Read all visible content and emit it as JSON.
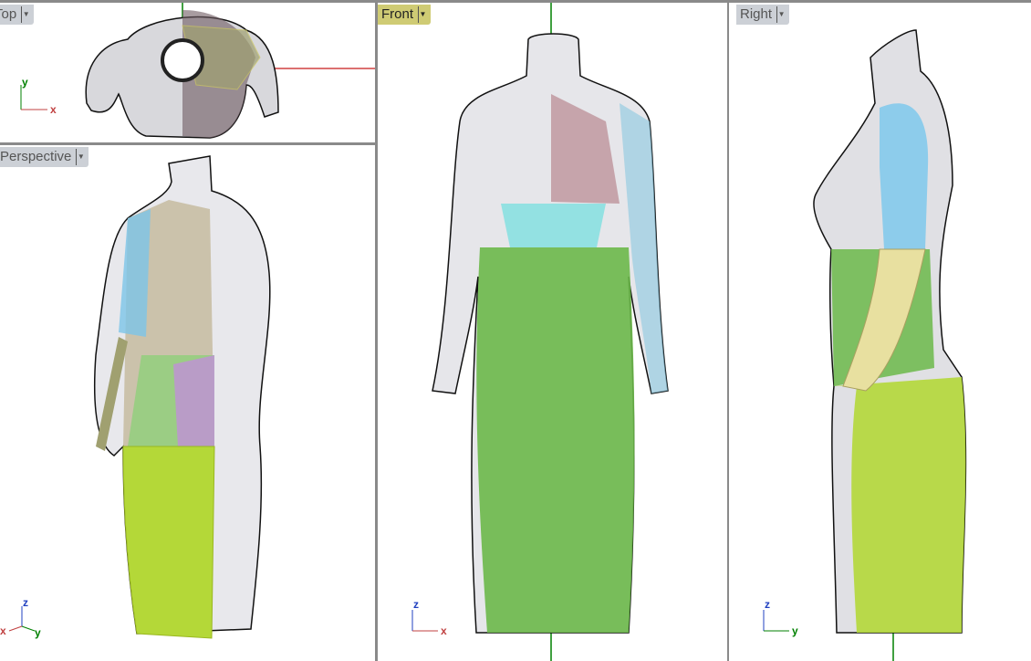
{
  "viewports": {
    "top": {
      "label": "Top",
      "axes": {
        "a": "y",
        "b": "x"
      }
    },
    "perspective": {
      "label": "Perspective",
      "axes": {
        "a": "z",
        "b": "x",
        "c": "y"
      }
    },
    "front": {
      "label": "Front",
      "axes": {
        "a": "z",
        "b": "x"
      }
    },
    "right": {
      "label": "Right",
      "axes": {
        "a": "z",
        "b": "y"
      }
    }
  },
  "active_viewport": "Front",
  "colors": {
    "active_tab": "#cfcb74",
    "tab": "#ccd0d6",
    "x_axis": "#c0392b",
    "y_axis": "#008000",
    "skirt": "#a9cf3a",
    "bodice_green": "#6bb84a"
  }
}
